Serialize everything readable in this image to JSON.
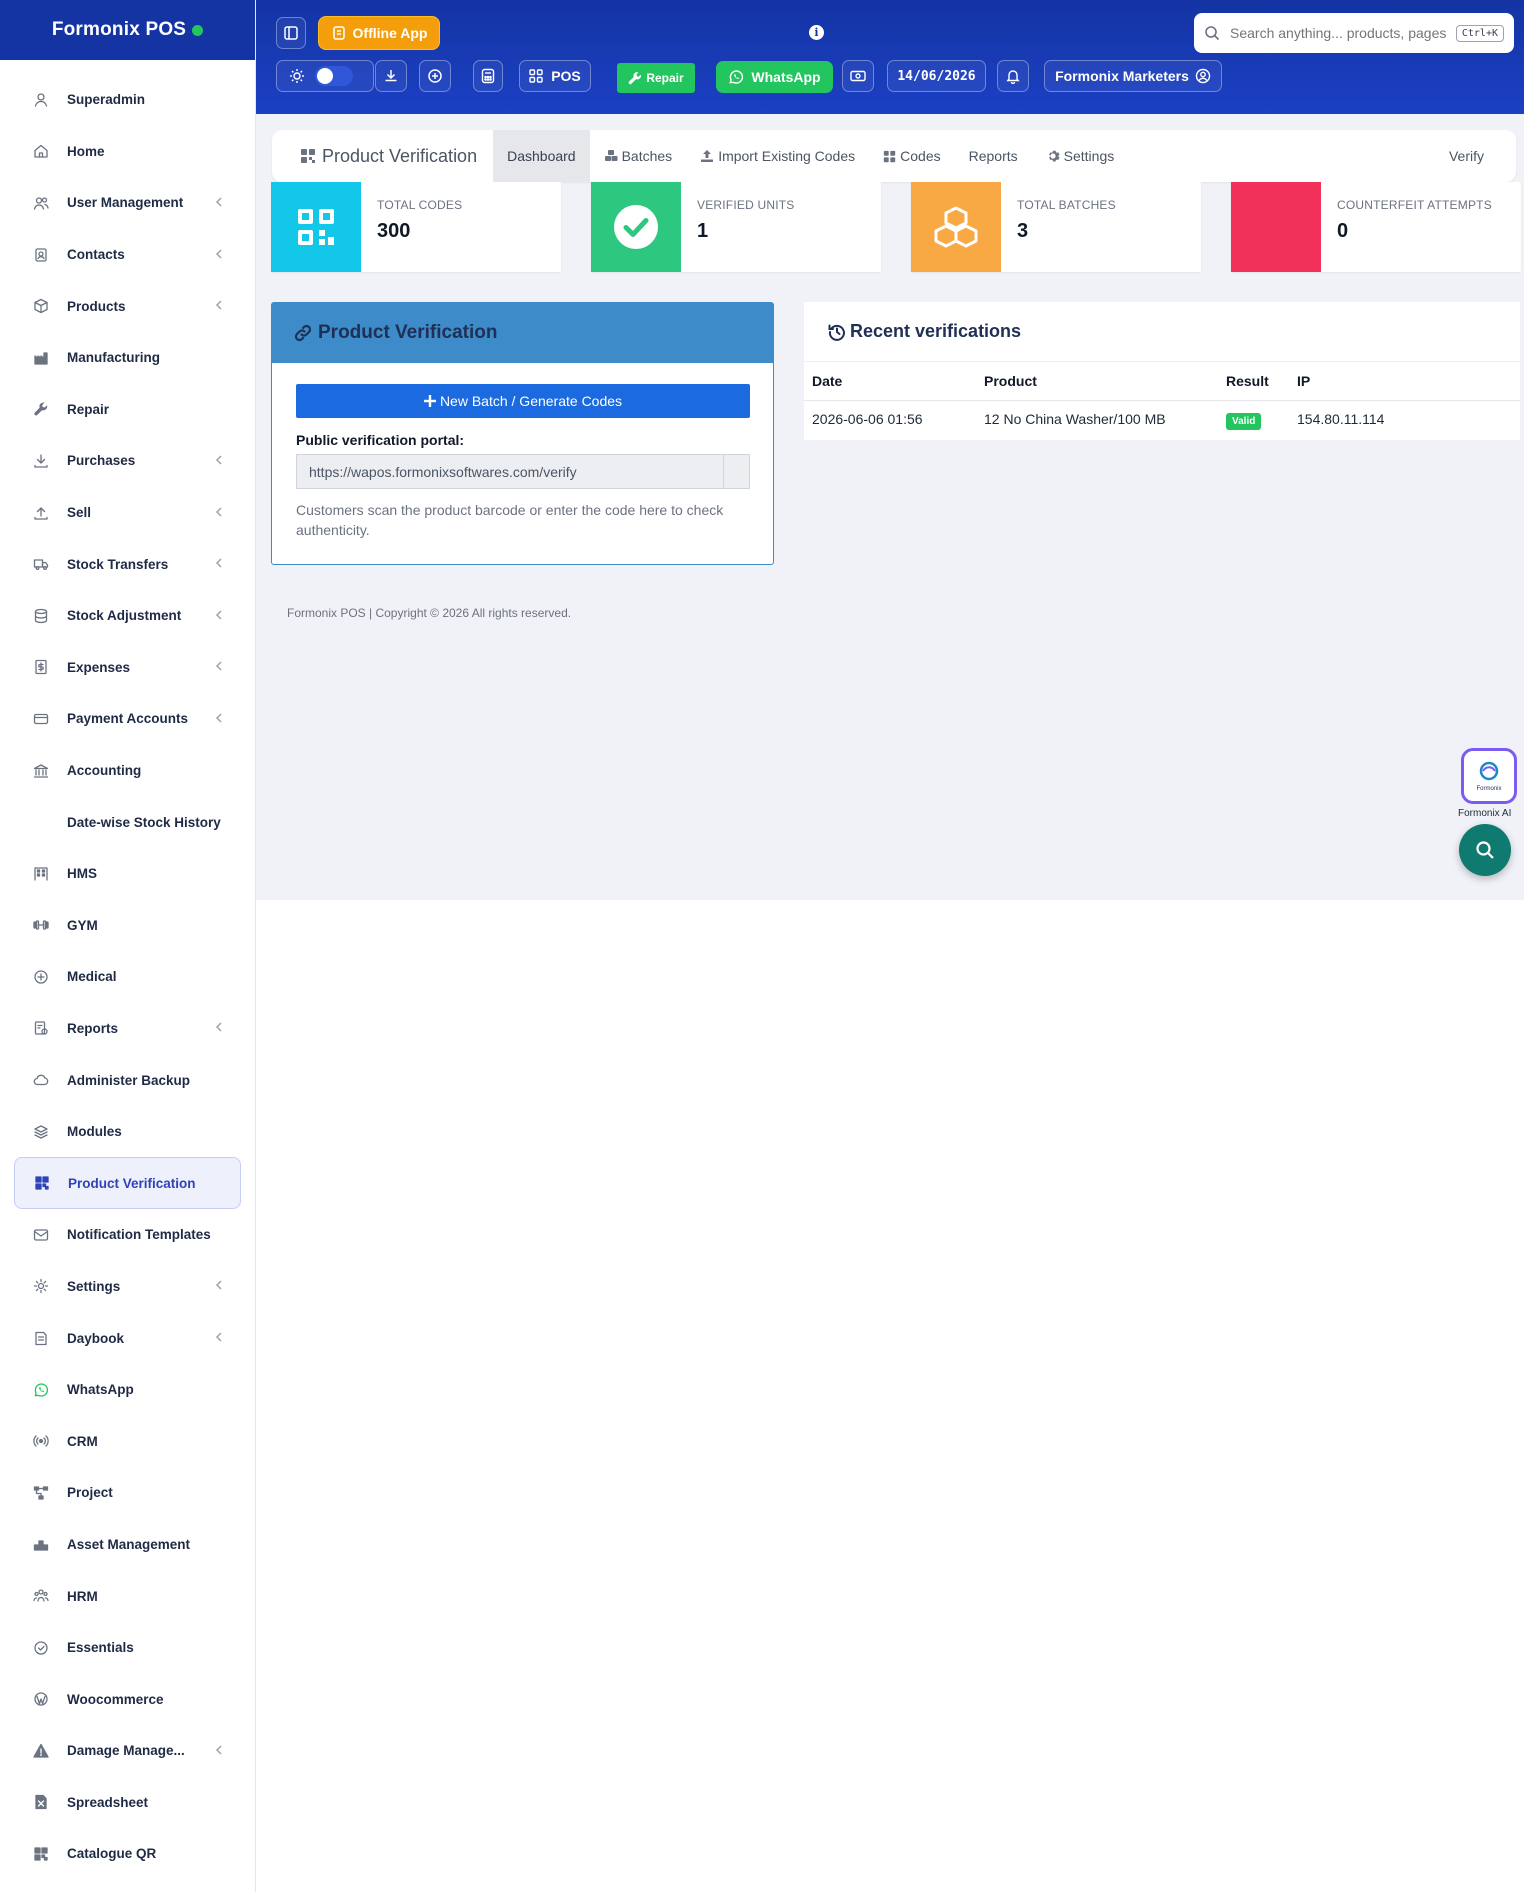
{
  "brand": {
    "name": "Formonix POS",
    "status_color": "#22c55e"
  },
  "header": {
    "offline_label": "Offline App",
    "search_placeholder": "Search anything... products, pages",
    "search_shortcut": "Ctrl+K",
    "pos_label": "POS",
    "repair_label": "Repair",
    "whatsapp_label": "WhatsApp",
    "date": "14/06/2026",
    "business": "Formonix Marketers"
  },
  "sidebar": {
    "items": [
      {
        "label": "Superadmin",
        "icon": "user-icon",
        "chevron": false
      },
      {
        "label": "Home",
        "icon": "home-icon",
        "chevron": false
      },
      {
        "label": "User Management",
        "icon": "users-icon",
        "chevron": true
      },
      {
        "label": "Contacts",
        "icon": "contacts-icon",
        "chevron": true
      },
      {
        "label": "Products",
        "icon": "box-icon",
        "chevron": true
      },
      {
        "label": "Manufacturing",
        "icon": "factory-icon",
        "chevron": false
      },
      {
        "label": "Repair",
        "icon": "wrench-icon",
        "chevron": false
      },
      {
        "label": "Purchases",
        "icon": "download-icon",
        "chevron": true
      },
      {
        "label": "Sell",
        "icon": "upload-icon",
        "chevron": true
      },
      {
        "label": "Stock Transfers",
        "icon": "truck-icon",
        "chevron": true
      },
      {
        "label": "Stock Adjustment",
        "icon": "database-icon",
        "chevron": true
      },
      {
        "label": "Expenses",
        "icon": "receipt-icon",
        "chevron": true
      },
      {
        "label": "Payment Accounts",
        "icon": "card-icon",
        "chevron": true
      },
      {
        "label": "Accounting",
        "icon": "bank-icon",
        "chevron": false
      },
      {
        "label": "Date-wise Stock History",
        "icon": "",
        "chevron": false
      },
      {
        "label": "HMS",
        "icon": "hotel-icon",
        "chevron": false
      },
      {
        "label": "GYM",
        "icon": "dumbbell-icon",
        "chevron": false
      },
      {
        "label": "Medical",
        "icon": "medical-icon",
        "chevron": false
      },
      {
        "label": "Reports",
        "icon": "report-icon",
        "chevron": true
      },
      {
        "label": "Administer Backup",
        "icon": "cloud-icon",
        "chevron": false
      },
      {
        "label": "Modules",
        "icon": "layers-icon",
        "chevron": false
      },
      {
        "label": "Product Verification",
        "icon": "qr-icon",
        "chevron": false,
        "active": true
      },
      {
        "label": "Notification Templates",
        "icon": "mail-icon",
        "chevron": false
      },
      {
        "label": "Settings",
        "icon": "gear-icon",
        "chevron": true
      },
      {
        "label": "Daybook",
        "icon": "book-icon",
        "chevron": true
      },
      {
        "label": "WhatsApp",
        "icon": "whatsapp-icon",
        "chevron": false
      },
      {
        "label": "CRM",
        "icon": "broadcast-icon",
        "chevron": false
      },
      {
        "label": "Project",
        "icon": "project-icon",
        "chevron": false
      },
      {
        "label": "Asset Management",
        "icon": "asset-icon",
        "chevron": false
      },
      {
        "label": "HRM",
        "icon": "team-icon",
        "chevron": false
      },
      {
        "label": "Essentials",
        "icon": "check-circle-icon",
        "chevron": false
      },
      {
        "label": "Woocommerce",
        "icon": "wordpress-icon",
        "chevron": false
      },
      {
        "label": "Damage Manage...",
        "icon": "warning-icon",
        "chevron": true
      },
      {
        "label": "Spreadsheet",
        "icon": "sheet-icon",
        "chevron": false
      },
      {
        "label": "Catalogue QR",
        "icon": "qr-icon",
        "chevron": false
      }
    ]
  },
  "tabs": {
    "title": "Product Verification",
    "items": [
      "Dashboard",
      "Batches",
      "Import Existing Codes",
      "Codes",
      "Reports",
      "Settings"
    ],
    "right": "Verify"
  },
  "stats": [
    {
      "label": "TOTAL CODES",
      "value": "300",
      "color": "#13c7e8",
      "icon": "qr-icon"
    },
    {
      "label": "VERIFIED UNITS",
      "value": "1",
      "color": "#2ec780",
      "icon": "check-circle-icon"
    },
    {
      "label": "TOTAL BATCHES",
      "value": "3",
      "color": "#f8a943",
      "icon": "boxes-icon"
    },
    {
      "label": "COUNTERFEIT ATTEMPTS",
      "value": "0",
      "color": "#f2315a",
      "icon": ""
    }
  ],
  "verification": {
    "title": "Product Verification",
    "button": "New Batch / Generate Codes",
    "portal_label": "Public verification portal:",
    "portal_url": "https://wapos.formonixsoftwares.com/verify",
    "help": "Customers scan the product barcode or enter the code here to check authenticity."
  },
  "recent": {
    "title": "Recent verifications",
    "columns": [
      "Date",
      "Product",
      "Result",
      "IP"
    ],
    "rows": [
      {
        "date": "2026-06-06 01:56",
        "product": "12 No China Washer/100 MB",
        "result": "Valid",
        "ip": "154.80.11.114"
      }
    ]
  },
  "footer": "Formonix POS | Copyright © 2026 All rights reserved.",
  "assistant": {
    "label": "Formonix AI",
    "logo_text": "Formonix"
  }
}
